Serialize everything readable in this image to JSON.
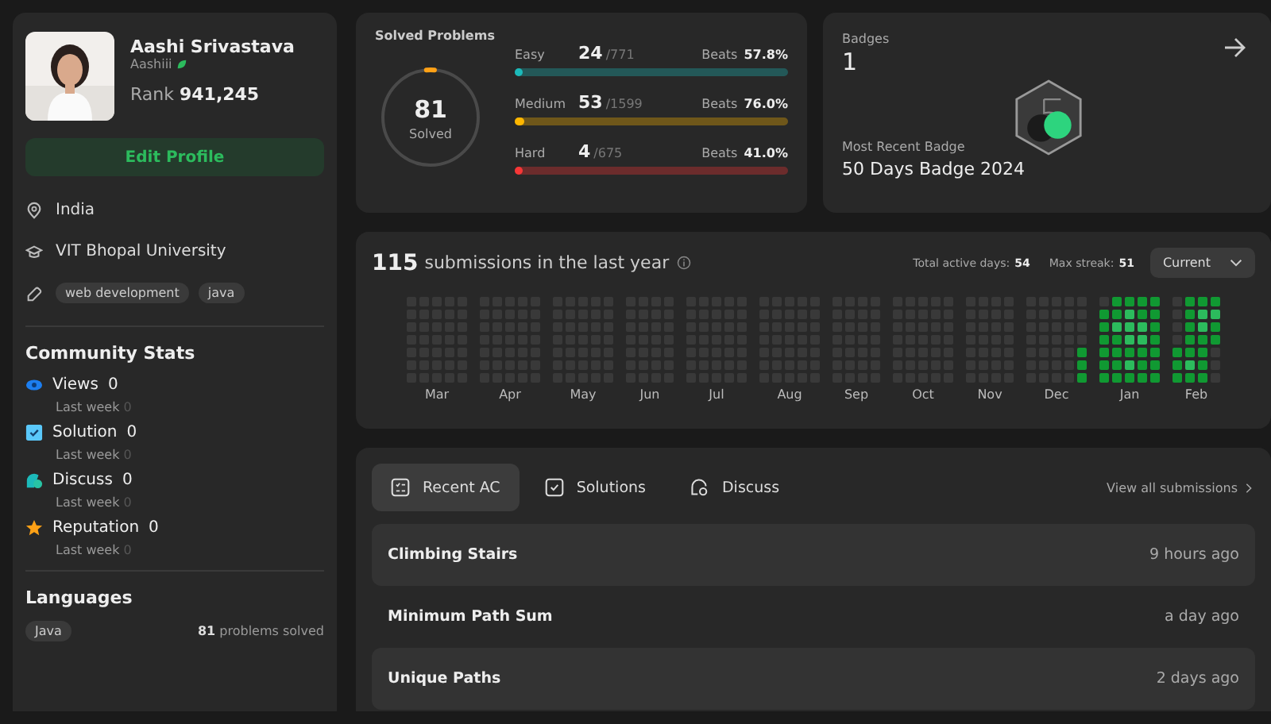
{
  "profile": {
    "avatar": {
      "kind": "picture"
    },
    "name": "Aashi Srivastava",
    "username": "Aashiii",
    "rank_label": "Rank",
    "rank": "941,245",
    "edit_button": "Edit Profile",
    "location": "India",
    "school": "VIT Bhopal University",
    "skills": [
      "web development",
      "java"
    ]
  },
  "community_stats": {
    "title": "Community Stats",
    "items": [
      {
        "kind": "views",
        "label": "Views",
        "value": "0",
        "sub_label": "Last week",
        "sub_value": "0"
      },
      {
        "kind": "solution",
        "label": "Solution",
        "value": "0",
        "sub_label": "Last week",
        "sub_value": "0"
      },
      {
        "kind": "discuss",
        "label": "Discuss",
        "value": "0",
        "sub_label": "Last week",
        "sub_value": "0"
      },
      {
        "kind": "reputation",
        "label": "Reputation",
        "value": "0",
        "sub_label": "Last week",
        "sub_value": "0"
      }
    ]
  },
  "languages": {
    "title": "Languages",
    "items": [
      {
        "name": "Java",
        "count": "81",
        "suffix": "problems solved"
      }
    ]
  },
  "solved": {
    "title": "Solved Problems",
    "count": "81",
    "caption": "Solved",
    "level": 0.027,
    "difficulties": [
      {
        "label": "Easy",
        "solved": "24",
        "total": "/771",
        "beats_label": "Beats",
        "beats": "57.8%",
        "level": 0.031,
        "color": "#1cbaba"
      },
      {
        "label": "Medium",
        "solved": "53",
        "total": "/1599",
        "beats_label": "Beats",
        "beats": "76.0%",
        "level": 0.033,
        "color": "#ffb700"
      },
      {
        "label": "Hard",
        "solved": "4",
        "total": "/675",
        "beats_label": "Beats",
        "beats": "41.0%",
        "level": 0.006,
        "color": "#f63737"
      }
    ]
  },
  "badges": {
    "title": "Badges",
    "count": "1",
    "recent_label": "Most Recent Badge",
    "recent_name": "50 Days Badge 2024"
  },
  "submissions": {
    "count": "115",
    "text": "submissions in the last year",
    "active_label": "Total active days:",
    "active_value": "54",
    "streak_label": "Max streak:",
    "streak_value": "51",
    "dropdown": "Current",
    "months": [
      {
        "label": "Mar"
      },
      {
        "label": "Apr"
      },
      {
        "label": "May"
      },
      {
        "label": "Jun"
      },
      {
        "label": "Jul"
      },
      {
        "label": "Aug"
      },
      {
        "label": "Sep"
      },
      {
        "label": "Oct"
      },
      {
        "label": "Nov"
      },
      {
        "label": "Dec"
      },
      {
        "label": "Jan"
      },
      {
        "label": "Feb"
      }
    ]
  },
  "recent": {
    "tabs": [
      {
        "kind": "list",
        "label": "Recent AC",
        "selected": true
      },
      {
        "kind": "check",
        "label": "Solutions",
        "selected": false
      },
      {
        "kind": "discuss",
        "label": "Discuss",
        "selected": false
      }
    ],
    "view_all": "View all submissions",
    "rows": [
      {
        "title": "Climbing Stairs",
        "time": "9 hours ago"
      },
      {
        "title": "Minimum Path Sum",
        "time": "a day ago"
      },
      {
        "title": "Unique Paths",
        "time": "2 days ago"
      }
    ]
  }
}
